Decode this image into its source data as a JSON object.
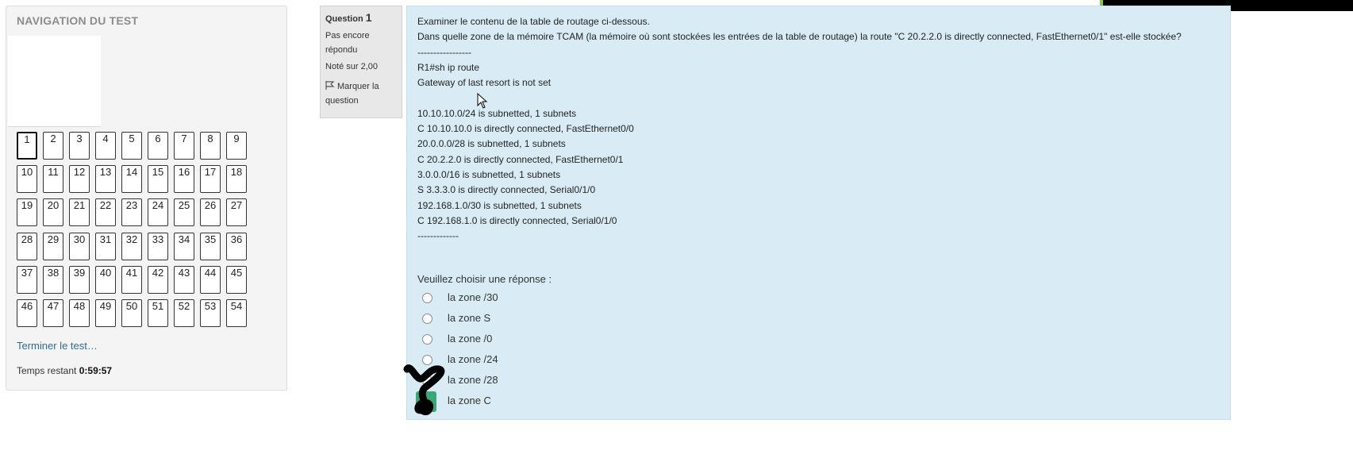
{
  "navigation": {
    "title": "NAVIGATION DU TEST",
    "current_question": 1,
    "questions": [
      "1",
      "2",
      "3",
      "4",
      "5",
      "6",
      "7",
      "8",
      "9",
      "10",
      "11",
      "12",
      "13",
      "14",
      "15",
      "16",
      "17",
      "18",
      "19",
      "20",
      "21",
      "22",
      "23",
      "24",
      "25",
      "26",
      "27",
      "28",
      "29",
      "30",
      "31",
      "32",
      "33",
      "34",
      "35",
      "36",
      "37",
      "38",
      "39",
      "40",
      "41",
      "42",
      "43",
      "44",
      "45",
      "46",
      "47",
      "48",
      "49",
      "50",
      "51",
      "52",
      "53",
      "54"
    ],
    "finish_link": "Terminer le test…",
    "timer_label": "Temps restant",
    "timer_value": "0:59:57"
  },
  "question_info": {
    "label": "Question",
    "number": "1",
    "state": "Pas encore répondu",
    "grade": "Noté sur 2,00",
    "flag_label": "Marquer la question",
    "flag_icon": "flag-icon"
  },
  "question": {
    "lines": [
      "Examiner le contenu de la table de routage ci-dessous.",
      "Dans quelle zone de la mémoire TCAM (la mémoire où sont stockées les entrées de la table de routage) la route \"C 20.2.2.0 is directly connected, FastEthernet0/1\" est-elle stockée?",
      "-----------------",
      "R1#sh ip route",
      "Gateway of last resort is not set",
      "",
      "10.10.10.0/24 is subnetted, 1 subnets",
      "C 10.10.10.0 is directly connected, FastEthernet0/0",
      "20.0.0.0/28 is subnetted, 1 subnets",
      "C 20.2.2.0 is directly connected, FastEthernet0/1",
      "3.0.0.0/16 is subnetted, 1 subnets",
      "S 3.3.3.0 is directly connected, Serial0/1/0",
      "192.168.1.0/30 is subnetted, 1 subnets",
      "C 192.168.1.0 is directly connected, Serial0/1/0",
      "-------------"
    ],
    "prompt": "Veuillez choisir une réponse :",
    "answers": [
      "la zone /30",
      "la zone S",
      "la zone /0",
      "la zone /24",
      "la zone /28",
      "la zone C"
    ],
    "selected_index": 5
  },
  "colors": {
    "panel_bg": "#f4f4f4",
    "content_bg": "#d9ecf5",
    "link": "#2c6b94",
    "selected": "#3aa876"
  }
}
